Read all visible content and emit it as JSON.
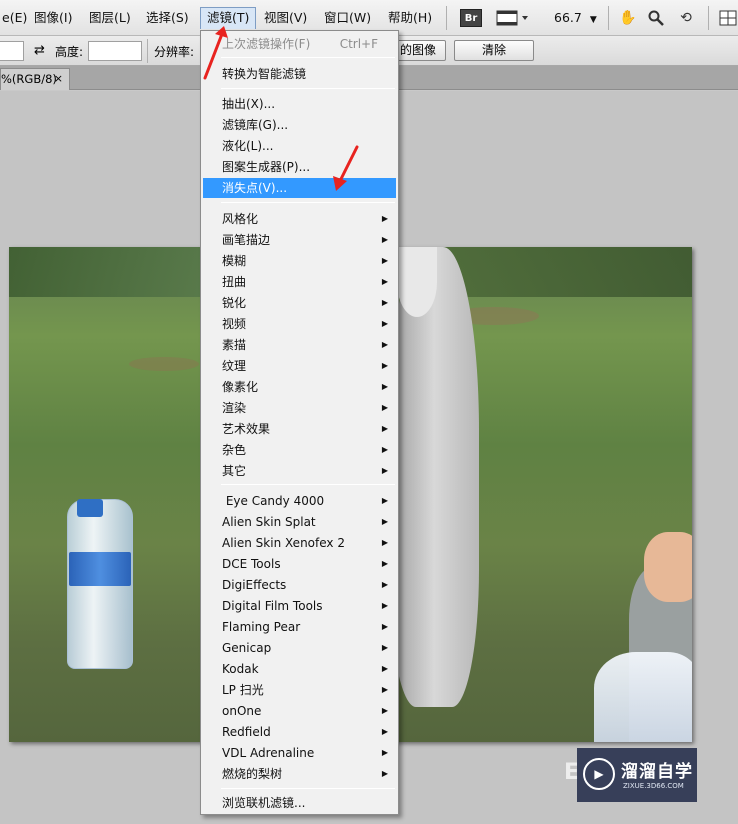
{
  "menubar": {
    "items": [
      {
        "label": "图像(I)"
      },
      {
        "label": "图层(L)"
      },
      {
        "label": "选择(S)"
      },
      {
        "label": "滤镜(T)"
      },
      {
        "label": "视图(V)"
      },
      {
        "label": "窗口(W)"
      },
      {
        "label": "帮助(H)"
      }
    ],
    "partial_first": "e(E)",
    "br_badge": "Br",
    "zoom": "66.7"
  },
  "options": {
    "swap_symbol": "⇄",
    "height_label": "高度:",
    "resolution_label": "分辨率:",
    "front_image_btn": "的图像",
    "clear_btn": "清除"
  },
  "tab": {
    "title": "%(RGB/8)",
    "close": "×"
  },
  "filter_menu": {
    "last_filter": {
      "label": "上次滤镜操作(F)",
      "shortcut": "Ctrl+F"
    },
    "convert_smart": "转换为智能滤镜",
    "group1": [
      "抽出(X)...",
      "滤镜库(G)...",
      "液化(L)...",
      "图案生成器(P)...",
      "消失点(V)..."
    ],
    "group2": [
      "风格化",
      "画笔描边",
      "模糊",
      "扭曲",
      "锐化",
      "视频",
      "素描",
      "纹理",
      "像素化",
      "渲染",
      "艺术效果",
      "杂色",
      "其它"
    ],
    "group3": [
      " Eye Candy 4000",
      "Alien Skin Splat",
      "Alien Skin Xenofex 2",
      "DCE Tools",
      "DigiEffects",
      "Digital Film Tools",
      "Flaming Pear",
      "Genicap",
      "Kodak",
      "LP 扫光",
      "onOne",
      "Redfield",
      "VDL Adrenaline",
      "燃烧的梨树"
    ],
    "browse": "浏览联机滤镜..."
  },
  "watermark": {
    "title": "溜溜自学",
    "url": "ZIXUE.3D66.COM"
  },
  "colors": {
    "highlight": "#3399ff",
    "annotation": "#e8231f"
  }
}
